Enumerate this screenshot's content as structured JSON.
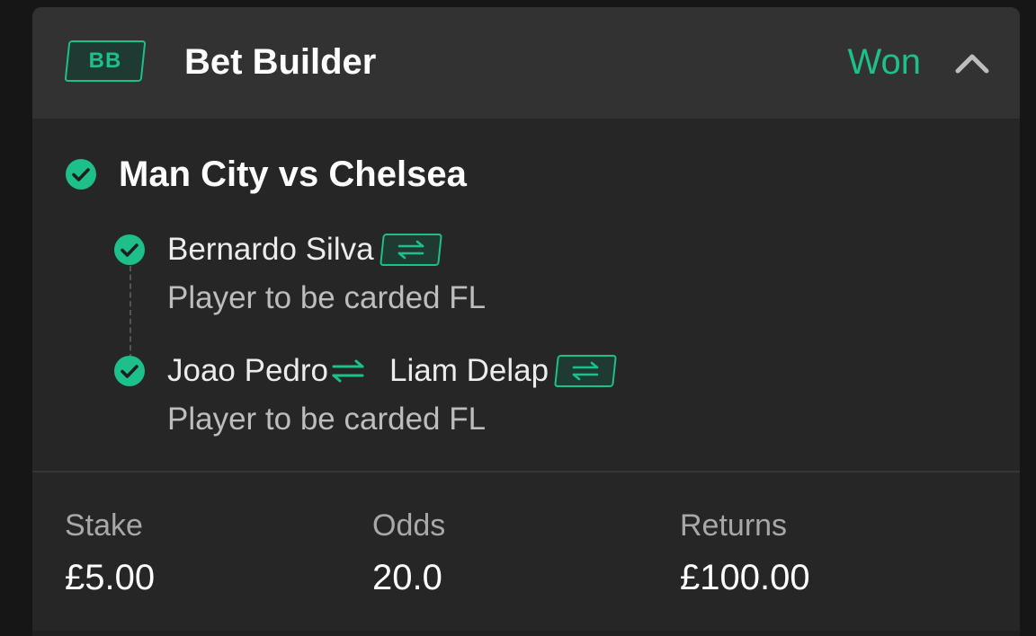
{
  "header": {
    "badge": "BB",
    "title": "Bet Builder",
    "status": "Won"
  },
  "match": {
    "title": "Man City vs Chelsea"
  },
  "selections": [
    {
      "player": "Bernardo Silva",
      "market": "Player to be carded FL"
    },
    {
      "player_out": "Joao Pedro",
      "player": "Liam Delap",
      "market": "Player to be carded FL"
    }
  ],
  "summary": {
    "stake_label": "Stake",
    "stake_value": "£5.00",
    "odds_label": "Odds",
    "odds_value": "20.0",
    "returns_label": "Returns",
    "returns_value": "£100.00"
  },
  "icons": {
    "check": "check-circle-icon",
    "swap": "swap-arrows-icon",
    "collapse": "chevron-up-icon"
  },
  "colors": {
    "accent": "#1dbf8a",
    "background": "#262626",
    "header_background": "#323232"
  }
}
